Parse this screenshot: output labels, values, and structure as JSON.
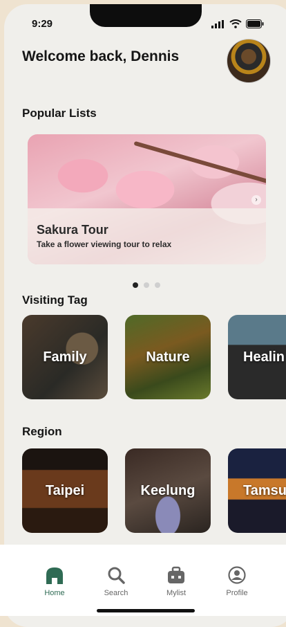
{
  "status": {
    "time": "9:29"
  },
  "header": {
    "greeting": "Welcome back, Dennis"
  },
  "sections": {
    "popular": "Popular Lists",
    "visiting": "Visiting Tag",
    "region": "Region"
  },
  "hero": {
    "title": "Sakura Tour",
    "subtitle": "Take a flower viewing tour to relax"
  },
  "carousel": {
    "page_count": 3,
    "active_index": 0
  },
  "tags": [
    {
      "label": "Family"
    },
    {
      "label": "Nature"
    },
    {
      "label": "Healin"
    }
  ],
  "regions": [
    {
      "label": "Taipei"
    },
    {
      "label": "Keelung"
    },
    {
      "label": "Tamsu"
    }
  ],
  "tabbar": {
    "items": [
      {
        "label": "Home",
        "icon": "home-icon",
        "active": true
      },
      {
        "label": "Search",
        "icon": "search-icon",
        "active": false
      },
      {
        "label": "Mylist",
        "icon": "bag-icon",
        "active": false
      },
      {
        "label": "Profile",
        "icon": "profile-icon",
        "active": false
      }
    ]
  },
  "colors": {
    "accent": "#2f6b54",
    "background": "#f0efeb"
  }
}
